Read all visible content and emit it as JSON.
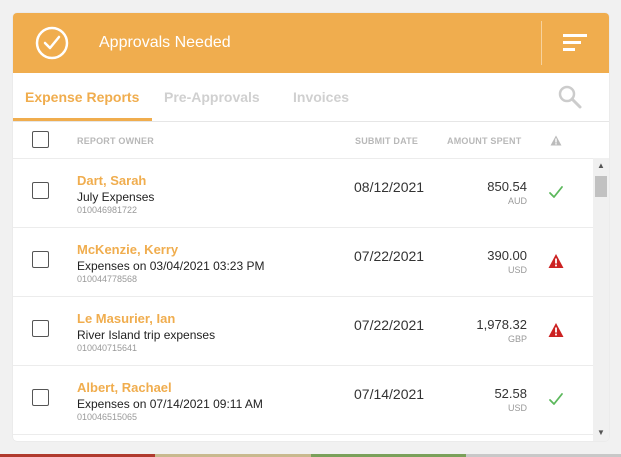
{
  "header": {
    "title": "Approvals Needed",
    "check_icon": "check-circle-icon",
    "menu_icon": "sort-menu-icon"
  },
  "tabs": [
    {
      "label": "Expense Reports",
      "active": true
    },
    {
      "label": "Pre-Approvals",
      "active": false
    },
    {
      "label": "Invoices",
      "active": false
    }
  ],
  "search_icon": "search-icon",
  "columns": {
    "owner": "REPORT OWNER",
    "date": "SUBMIT DATE",
    "amount": "AMOUNT SPENT",
    "alert_icon": "warning-icon"
  },
  "rows": [
    {
      "owner": "Dart, Sarah",
      "title": "July Expenses",
      "id": "010046981722",
      "date": "08/12/2021",
      "amount": "850.54",
      "currency": "AUD",
      "status": "ok"
    },
    {
      "owner": "McKenzie, Kerry",
      "title": "Expenses on 03/04/2021 03:23 PM",
      "id": "010044778568",
      "date": "07/22/2021",
      "amount": "390.00",
      "currency": "USD",
      "status": "warning"
    },
    {
      "owner": "Le Masurier, Ian",
      "title": "River Island trip expenses",
      "id": "010040715641",
      "date": "07/22/2021",
      "amount": "1,978.32",
      "currency": "GBP",
      "status": "warning"
    },
    {
      "owner": "Albert, Rachael",
      "title": "Expenses on 07/14/2021 09:11 AM",
      "id": "010046515065",
      "date": "07/14/2021",
      "amount": "52.58",
      "currency": "USD",
      "status": "ok"
    }
  ],
  "colors": {
    "accent": "#f0ad4e",
    "ok": "#5cb85c",
    "warning": "#cc2222",
    "strip": [
      "#b03a2e",
      "#c8b98e",
      "#7aa05a",
      "#c8c8c8"
    ]
  }
}
